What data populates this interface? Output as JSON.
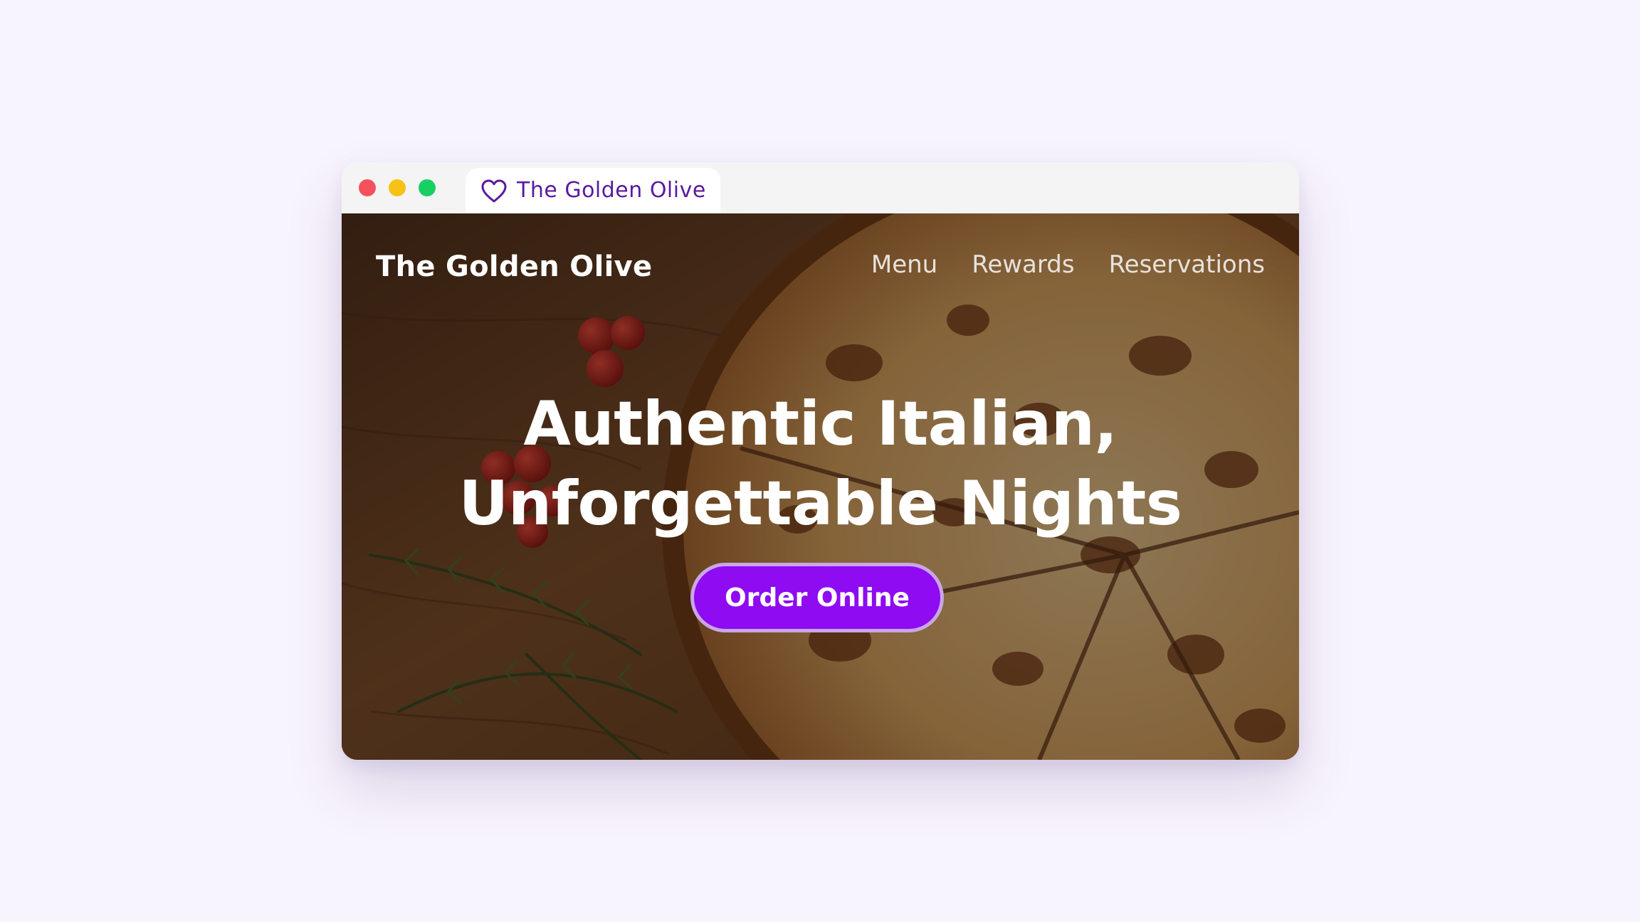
{
  "window": {
    "tab_title": "The Golden Olive",
    "tab_icon": "heart-icon"
  },
  "site": {
    "brand": "The Golden Olive",
    "nav": [
      {
        "label": "Menu"
      },
      {
        "label": "Rewards"
      },
      {
        "label": "Reservations"
      }
    ]
  },
  "hero": {
    "headline_line1": "Authentic Italian,",
    "headline_line2": "Unforgettable Nights",
    "cta_label": "Order Online",
    "background_image": "pizza-photo"
  },
  "colors": {
    "page_background": "#f8f4fd",
    "accent": "#8f0bf1",
    "tab_text": "#5a1a9e",
    "traffic_red": "#f4515d",
    "traffic_yellow": "#f8c116",
    "traffic_green": "#18cf62"
  }
}
